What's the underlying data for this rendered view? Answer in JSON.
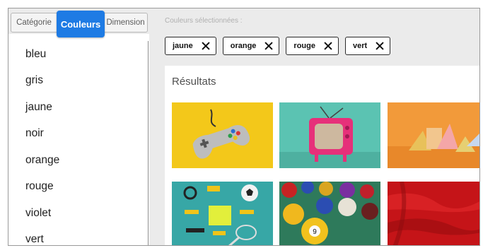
{
  "tabs": [
    {
      "label": "Catégorie"
    },
    {
      "label": "Couleurs"
    },
    {
      "label": "Dimension"
    }
  ],
  "colors": [
    "bleu",
    "gris",
    "jaune",
    "noir",
    "orange",
    "rouge",
    "violet",
    "vert"
  ],
  "selected": {
    "label": "Couleurs sélectionnées :",
    "chips": [
      "jaune",
      "orange",
      "rouge",
      "vert"
    ]
  },
  "results": {
    "title": "Résultats",
    "images": [
      {
        "icon": "game-controller-photo",
        "bg": "#f3c81a"
      },
      {
        "icon": "pink-tv-photo",
        "bg": "#59c1b0"
      },
      {
        "icon": "geometric-shapes-photo",
        "bg": "#f29a3a"
      },
      {
        "icon": "sports-equipment-photo",
        "bg": "#37a7a6"
      },
      {
        "icon": "billiard-balls-photo",
        "bg": "#2e7a5b"
      },
      {
        "icon": "red-curtain-photo",
        "bg": "#c51418"
      }
    ]
  },
  "accent": "#1e7be4"
}
